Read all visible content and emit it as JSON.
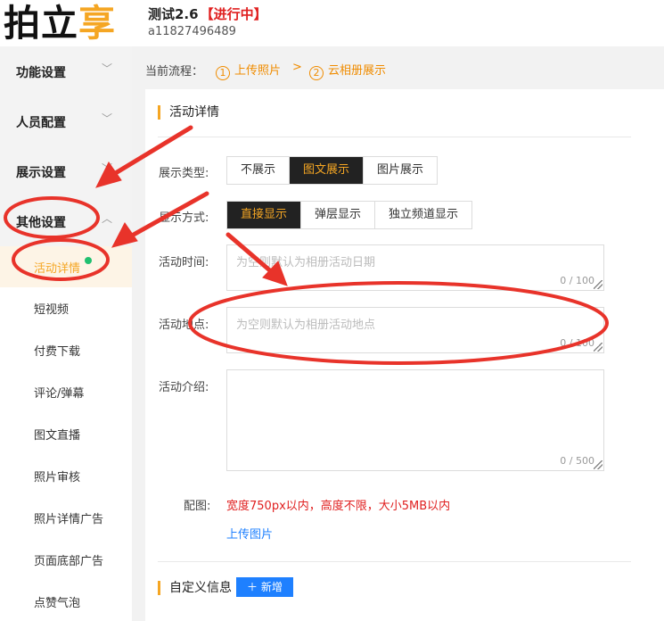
{
  "header": {
    "logo_main": "拍立",
    "logo_accent": "享",
    "title": "测试2.6",
    "status": "【进行中】",
    "account": "a11827496489"
  },
  "sidebar": {
    "groups": [
      {
        "label": "功能设置"
      },
      {
        "label": "人员配置"
      },
      {
        "label": "展示设置"
      },
      {
        "label": "其他设置"
      }
    ],
    "items": [
      {
        "label": "活动详情"
      },
      {
        "label": "短视频"
      },
      {
        "label": "付费下载"
      },
      {
        "label": "评论/弹幕"
      },
      {
        "label": "图文直播"
      },
      {
        "label": "照片审核"
      },
      {
        "label": "照片详情广告"
      },
      {
        "label": "页面底部广告"
      },
      {
        "label": "点赞气泡"
      }
    ]
  },
  "flow": {
    "label": "当前流程：",
    "step1_num": "1",
    "step1": "上传照片",
    "sep": ">",
    "step2_num": "2",
    "step2": "云相册展示"
  },
  "detail": {
    "section_title": "活动详情",
    "display_type_label": "展示类型:",
    "display_type_options": [
      "不展示",
      "图文展示",
      "图片展示"
    ],
    "display_type_selected": "图文展示",
    "display_mode_label": "显示方式:",
    "display_mode_options": [
      "直接显示",
      "弹层显示",
      "独立频道显示"
    ],
    "display_mode_selected": "直接显示",
    "time_label": "活动时间:",
    "time_placeholder": "为空则默认为相册活动日期",
    "time_count": "0 / 100",
    "place_label": "活动地点:",
    "place_placeholder": "为空则默认为相册活动地点",
    "place_count": "0 / 100",
    "intro_label": "活动介绍:",
    "intro_count": "0 / 500",
    "image_label": "配图:",
    "image_hint": "宽度750px以内，高度不限，大小5MB以内",
    "upload_link": "上传图片",
    "custom_title": "自定义信息",
    "add_button": "新增",
    "add_icon": "plus-icon"
  },
  "colors": {
    "accent": "#f5a623",
    "danger": "#e02020",
    "link": "#1e80ff",
    "dark": "#222222"
  }
}
